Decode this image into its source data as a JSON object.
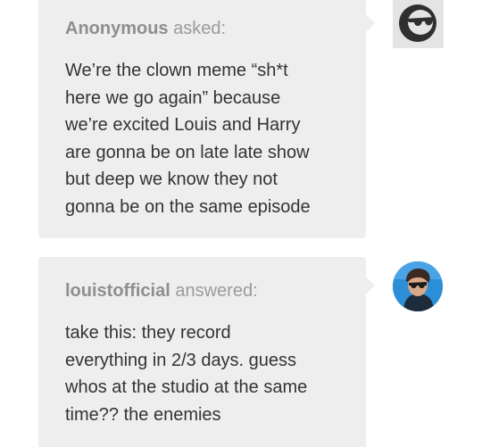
{
  "ask": {
    "asker_name": "Anonymous",
    "asker_verb": "asked:",
    "question": "We’re the clown meme “sh*t\nhere we go again” because\nwe’re excited Louis and Harry\nare gonna be on late late show\nbut deep we know they not\ngonna be on the same episode",
    "avatar_icon": "sunglasses-face-icon"
  },
  "answer": {
    "answerer_name": "louistofficial",
    "answerer_verb": "answered:",
    "text": "take this: they record\neverything in 2/3 days. guess\nwhos at the studio at the same\ntime?? the enemies",
    "avatar_icon": "profile-photo"
  },
  "colors": {
    "bubble_bg": "#eeeeee",
    "text": "#333333",
    "byline": "#9b9b9b",
    "avatar_blue": "#2d8ed8"
  }
}
